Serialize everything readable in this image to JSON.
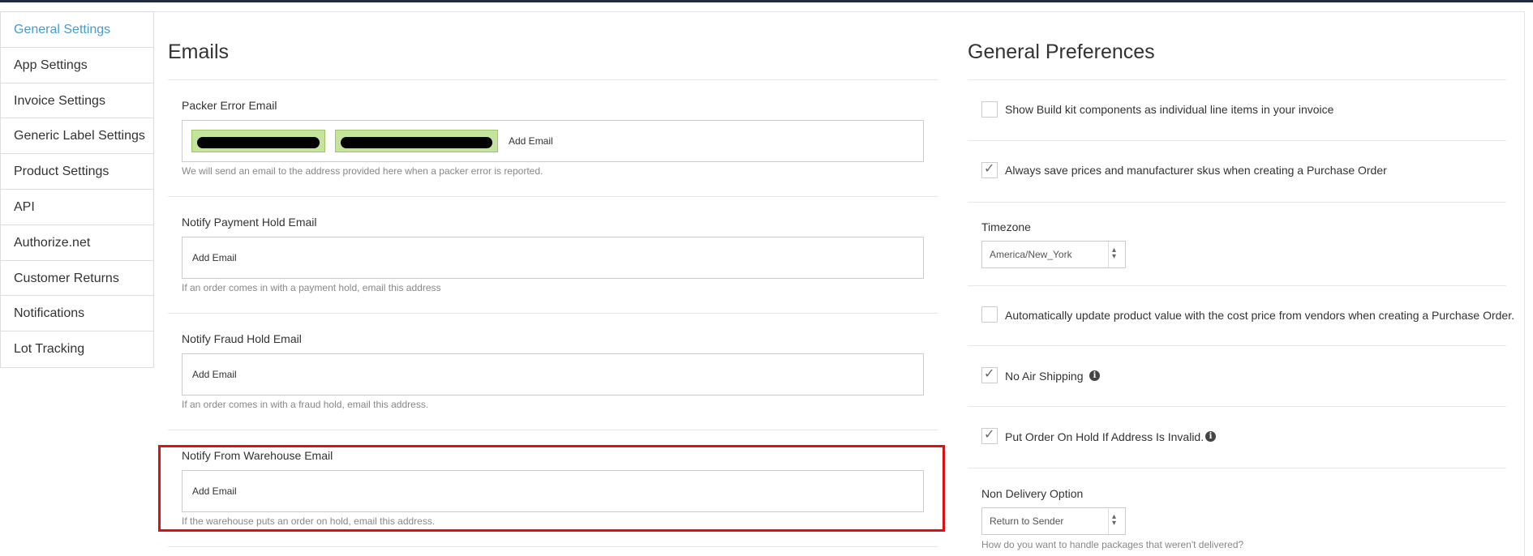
{
  "sidebar": {
    "items": [
      {
        "label": "General Settings"
      },
      {
        "label": "App Settings"
      },
      {
        "label": "Invoice Settings"
      },
      {
        "label": "Generic Label Settings"
      },
      {
        "label": "Product Settings"
      },
      {
        "label": "API"
      },
      {
        "label": "Authorize.net"
      },
      {
        "label": "Customer Returns"
      },
      {
        "label": "Notifications"
      },
      {
        "label": "Lot Tracking"
      }
    ]
  },
  "emails": {
    "title": "Emails",
    "packer_error": {
      "label": "Packer Error Email",
      "add_label": "Add Email",
      "help": "We will send an email to the address provided here when a packer error is reported."
    },
    "payment_hold": {
      "label": "Notify Payment Hold Email",
      "add_label": "Add Email",
      "help": "If an order comes in with a payment hold, email this address"
    },
    "fraud_hold": {
      "label": "Notify Fraud Hold Email",
      "add_label": "Add Email",
      "help": "If an order comes in with a fraud hold, email this address."
    },
    "warehouse": {
      "label": "Notify From Warehouse Email",
      "add_label": "Add Email",
      "help": "If the warehouse puts an order on hold, email this address."
    }
  },
  "preferences": {
    "title": "General Preferences",
    "build_kit": {
      "label": "Show Build kit components as individual line items in your invoice",
      "checked": false
    },
    "save_prices": {
      "label": "Always save prices and manufacturer skus when creating a Purchase Order",
      "checked": true
    },
    "timezone": {
      "label": "Timezone",
      "value": "America/New_York"
    },
    "auto_update": {
      "label": "Automatically update product value with the cost price from vendors when creating a Purchase Order.",
      "checked": false
    },
    "no_air": {
      "label": "No Air Shipping",
      "checked": true
    },
    "hold_invalid": {
      "label": "Put Order On Hold If Address Is Invalid.",
      "checked": true
    },
    "non_delivery": {
      "label": "Non Delivery Option",
      "value": "Return to Sender",
      "help": "How do you want to handle packages that weren't delivered?"
    }
  },
  "icons": {
    "check": "✓",
    "info": "i",
    "select_arrows": "▲▼"
  }
}
